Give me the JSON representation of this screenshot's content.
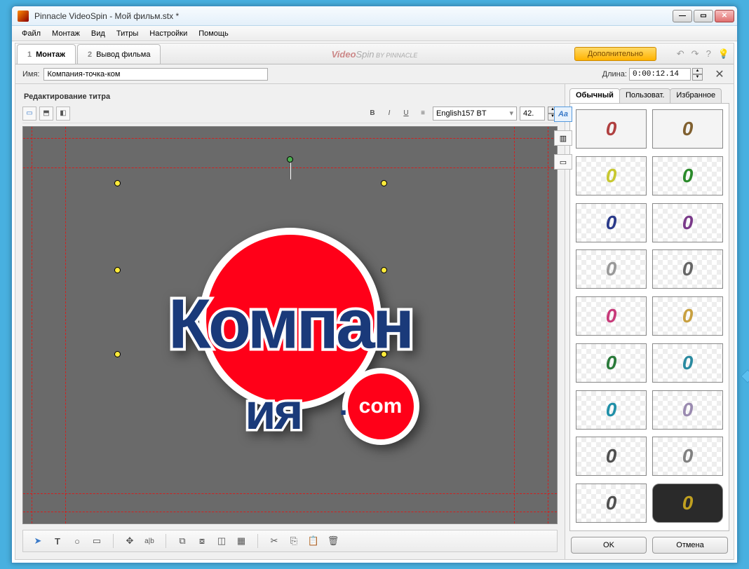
{
  "window": {
    "title": "Pinnacle VideoSpin - Мой фильм.stx *"
  },
  "menu": [
    "Файл",
    "Монтаж",
    "Вид",
    "Титры",
    "Настройки",
    "Помощь"
  ],
  "mainTabs": [
    {
      "num": "1",
      "label": "Монтаж",
      "active": true
    },
    {
      "num": "2",
      "label": "Вывод фильма",
      "active": false
    }
  ],
  "brand": {
    "video": "Video",
    "spin": "Spin",
    "by": " BY PINNACLE"
  },
  "extraBtn": "Дополнительно",
  "nameLabel": "Имя:",
  "nameValue": "Компания-точка-ком",
  "durLabel": "Длина:",
  "durValue": "0:00:12.14",
  "sectionTitle": "Редактирование титра",
  "font": {
    "name": "English157 BT",
    "size": "42."
  },
  "canvasText": {
    "line1": "Компан",
    "line2": "ия",
    "dotcom": "com"
  },
  "styleTabs": [
    "Обычный",
    "Пользоват.",
    "Избранное"
  ],
  "swatches": [
    {
      "c": "#b04040",
      "bg": false
    },
    {
      "c": "#806030",
      "bg": false
    },
    {
      "c": "#c8c830",
      "bg": true
    },
    {
      "c": "#2a8a2a",
      "bg": true
    },
    {
      "c": "#2a3a8a",
      "bg": true
    },
    {
      "c": "#7a3a8a",
      "bg": true
    },
    {
      "c": "#999999",
      "bg": true
    },
    {
      "c": "#666666",
      "bg": true
    },
    {
      "c": "#c83a7a",
      "bg": true
    },
    {
      "c": "#c8a040",
      "bg": true
    },
    {
      "c": "#2a7a3a",
      "bg": true
    },
    {
      "c": "#2a8aa0",
      "bg": true
    },
    {
      "c": "#2090a8",
      "bg": true
    },
    {
      "c": "#9a8ab0",
      "bg": true
    },
    {
      "c": "#505050",
      "bg": true
    },
    {
      "c": "#808080",
      "bg": true
    },
    {
      "c": "#505050",
      "bg": true
    },
    {
      "c": "#c0a020",
      "bg": false
    }
  ],
  "buttons": {
    "ok": "OK",
    "cancel": "Отмена"
  }
}
